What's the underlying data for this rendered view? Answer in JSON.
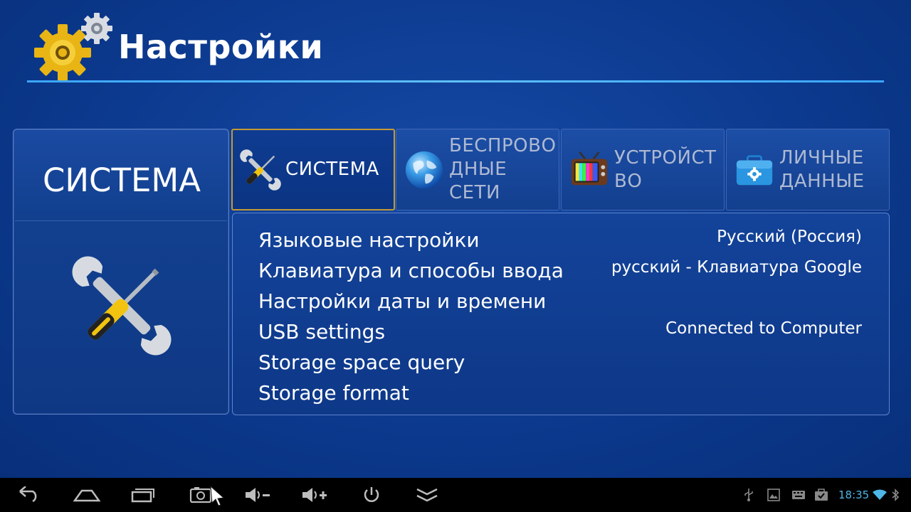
{
  "header": {
    "title": "Настройки",
    "icon": "gears-icon"
  },
  "left_panel": {
    "title": "СИСТЕМА",
    "icon": "tools-icon"
  },
  "tabs": [
    {
      "label": "СИСТЕМА",
      "icon": "tools-icon",
      "active": true
    },
    {
      "label": "БЕСПРОВО\nДНЫЕ\nСЕТИ",
      "icon": "globe-icon",
      "active": false
    },
    {
      "label": "УСТРОЙСТ\nВО",
      "icon": "tv-icon",
      "active": false
    },
    {
      "label": "ЛИЧНЫЕ\nДАННЫЕ",
      "icon": "briefcase-gear-icon",
      "active": false
    }
  ],
  "settings": [
    {
      "label": "Языковые настройки",
      "value": "Русский (Россия)"
    },
    {
      "label": "Клавиатура и способы ввода",
      "value": "русский - Клавиатура Google"
    },
    {
      "label": "Настройки даты и времени",
      "value": ""
    },
    {
      "label": "USB settings",
      "value": "Connected to Computer"
    },
    {
      "label": "Storage space query",
      "value": ""
    },
    {
      "label": "Storage format",
      "value": ""
    }
  ],
  "navbar": {
    "buttons": [
      "back-icon",
      "home-icon",
      "recent-apps-icon",
      "screenshot-icon",
      "volume-down-icon",
      "volume-up-icon",
      "power-icon",
      "hide-bar-icon"
    ],
    "status_icons": [
      "usb-icon",
      "image-icon",
      "keyboard-icon",
      "download-done-icon",
      "wifi-icon",
      "bluetooth-icon"
    ],
    "time": "18:35"
  },
  "colors": {
    "background": "#0c3a8f",
    "accent_rule": "#4ab3ff",
    "active_tab_border": "#c59a34",
    "clock": "#4fb6e8"
  }
}
